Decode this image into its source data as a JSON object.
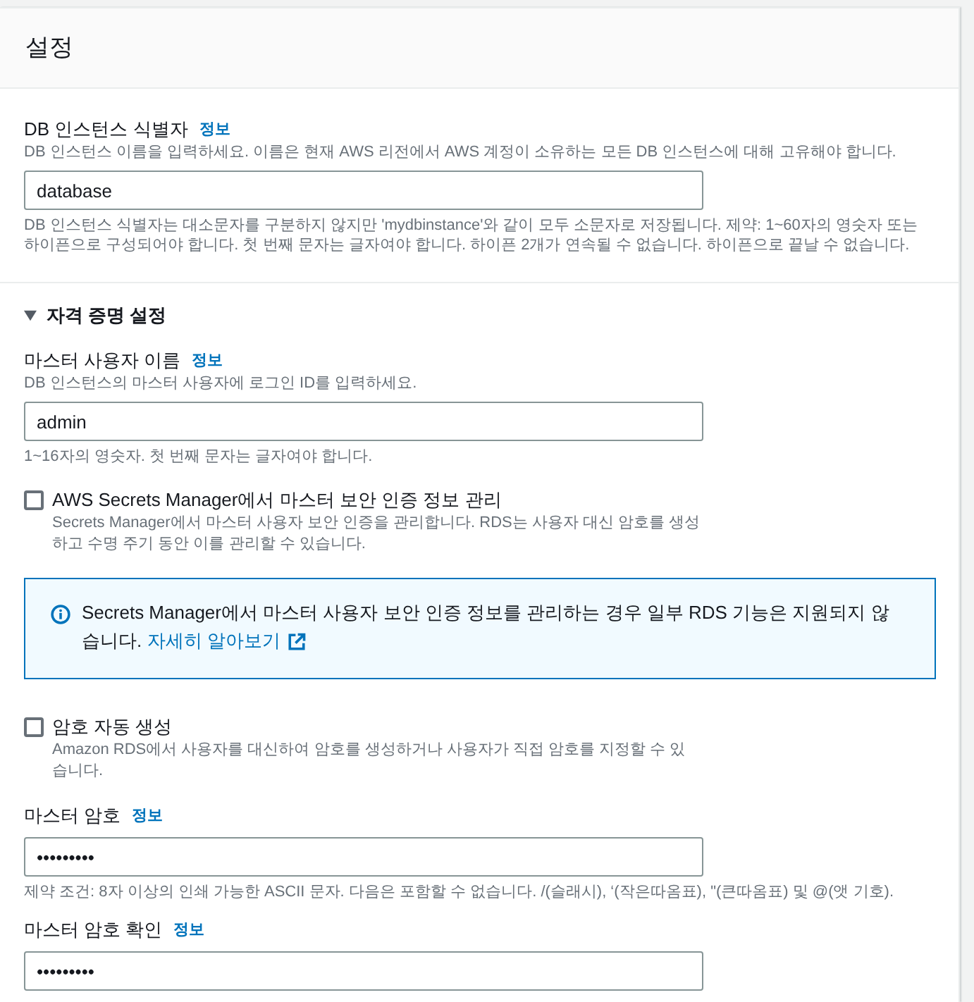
{
  "panel": {
    "title": "설정"
  },
  "fields": [
    {
      "kind": "text",
      "label": "DB 인스턴스 식별자",
      "info": "정보",
      "description": "DB 인스턴스 이름을 입력하세요. 이름은 현재 AWS 리전에서 AWS 계정이 소유하는 모든 DB 인스턴스에 대해 고유해야 합니다.",
      "value": "database",
      "constraint": "DB 인스턴스 식별자는 대소문자를 구분하지 않지만 'mydbinstance'와 같이 모두 소문자로 저장됩니다. 제약: 1~60자의 영숫자 또는 하이픈으로 구성되어야 합니다. 첫 번째 문자는 글자여야 합니다. 하이픈 2개가 연속될 수 없습니다. 하이픈으로 끝날 수 없습니다."
    }
  ],
  "credentials": {
    "title": "자격 증명 설정",
    "expanded": true,
    "items": [
      {
        "kind": "text",
        "label": "마스터 사용자 이름",
        "info": "정보",
        "description": "DB 인스턴스의 마스터 사용자에 로그인 ID를 입력하세요.",
        "value": "admin",
        "constraint": "1~16자의 영숫자. 첫 번째 문자는 글자여야 합니다."
      },
      {
        "kind": "checkbox",
        "label": "AWS Secrets Manager에서 마스터 보안 인증 정보 관리",
        "description": "Secrets Manager에서 마스터 사용자 보안 인증을 관리합니다. RDS는 사용자 대신 암호를 생성하고 수명 주기 동안 이를 관리할 수 있습니다.",
        "checked": false
      },
      {
        "kind": "alert",
        "text": "Secrets Manager에서 마스터 사용자 보안 인증 정보를 관리하는 경우 일부 RDS 기능은 지원되지 않습니다.",
        "link": "자세히 알아보기"
      },
      {
        "kind": "checkbox",
        "label": "암호 자동 생성",
        "description": "Amazon RDS에서 사용자를 대신하여 암호를 생성하거나 사용자가 직접 암호를 지정할 수 있습니다.",
        "checked": false
      },
      {
        "kind": "password",
        "label": "마스터 암호",
        "info": "정보",
        "value": "•••••••••",
        "constraint": "제약 조건: 8자 이상의 인쇄 가능한 ASCII 문자. 다음은 포함할 수 없습니다. /(슬래시), ‘(작은따옴표), \"(큰따옴표) 및 @(앳 기호)."
      },
      {
        "kind": "password",
        "label": "마스터 암호 확인",
        "info": "정보",
        "value": "•••••••••"
      }
    ]
  }
}
